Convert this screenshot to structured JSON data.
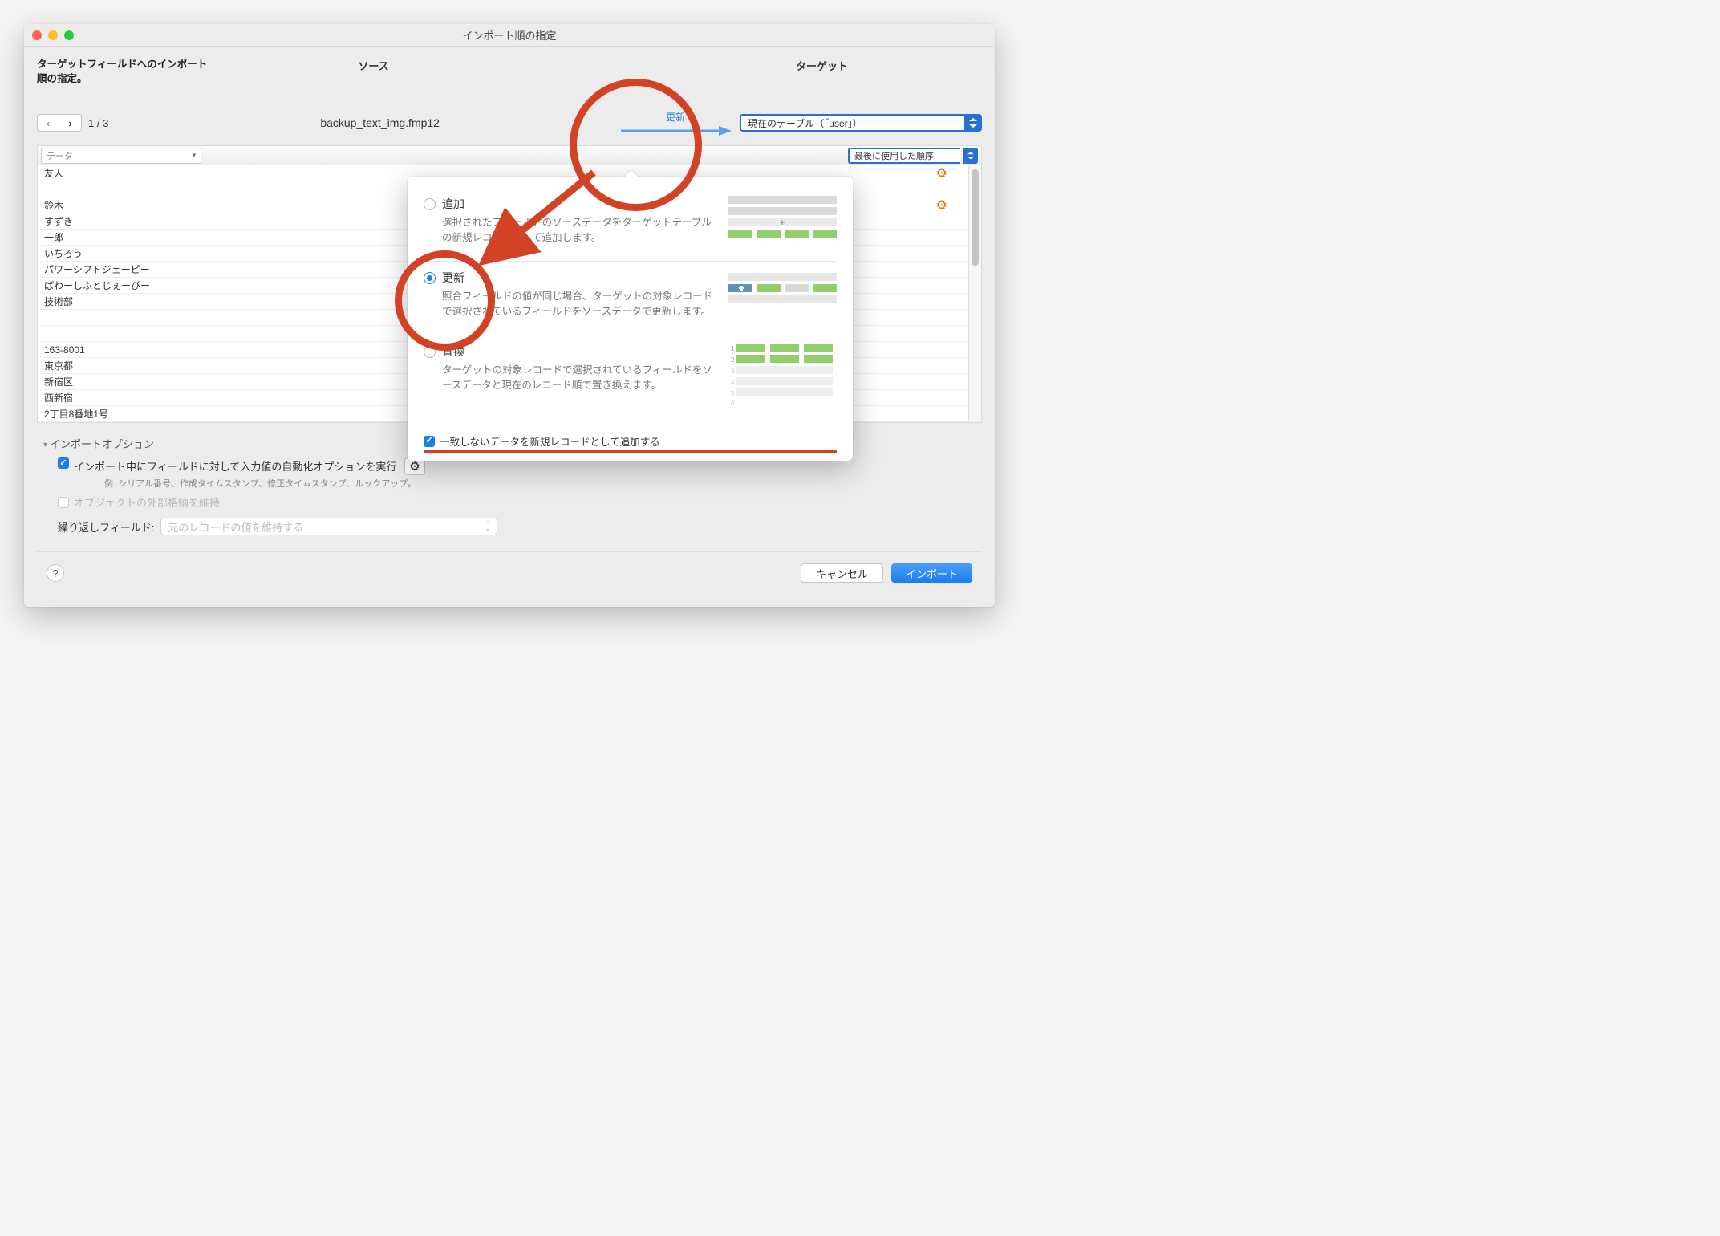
{
  "window_title": "インポート順の指定",
  "header_text": "ターゲットフィールドへのインポート順の指定。",
  "source_label": "ソース",
  "target_label": "ターゲット",
  "source_file": "backup_text_img.fmp12",
  "arrow_mode_label": "更新",
  "target_table": "現在のテーブル（「user」）",
  "page_indicator": "1 / 3",
  "data_header": "データ",
  "order_header": "最後に使用した順序",
  "rows": [
    {
      "name": "友人",
      "gear": true
    },
    {
      "name": ""
    },
    {
      "name": "鈴木",
      "gear": true
    },
    {
      "name": "すずき"
    },
    {
      "name": "一郎"
    },
    {
      "name": "いちろう"
    },
    {
      "name": "パワーシフトジェーピー"
    },
    {
      "name": "ぱわーしふとじぇーぴー"
    },
    {
      "name": "技術部"
    },
    {
      "name": ""
    },
    {
      "name": ""
    },
    {
      "name": "163-8001"
    },
    {
      "name": "東京都"
    },
    {
      "name": "新宿区"
    },
    {
      "name": "西新宿"
    },
    {
      "name": "2丁目8番地1号"
    }
  ],
  "options_header": "インポートオプション",
  "auto_opt_label": "インポート中にフィールドに対して入力値の自動化オプションを実行",
  "auto_opt_sub": "例: シリアル番号、作成タイムスタンプ、修正タイムスタンプ、ルックアップ。",
  "ext_storage_label": "オブジェクトの外部格納を維持",
  "repeat_label": "繰り返しフィールド:",
  "repeat_value": "元のレコードの値を維持する",
  "btn_cancel": "キャンセル",
  "btn_import": "インポート",
  "popover": {
    "add": {
      "title": "追加",
      "desc": "選択されたフィールドのソースデータをターゲットテーブルの新規レコードとして追加します。"
    },
    "update": {
      "title": "更新",
      "desc": "照合フィールドの値が同じ場合、ターゲットの対象レコードで選択されているフィールドをソースデータで更新します。"
    },
    "replace": {
      "title": "置換",
      "desc": "ターゲットの対象レコードで選択されているフィールドをソースデータと現在のレコード順で置き換えます。"
    },
    "add_unmatched": "一致しないデータを新規レコードとして追加する"
  },
  "colors": {
    "accent": "#1a7df0",
    "annot": "#d24326",
    "green": "#93ce6e"
  }
}
